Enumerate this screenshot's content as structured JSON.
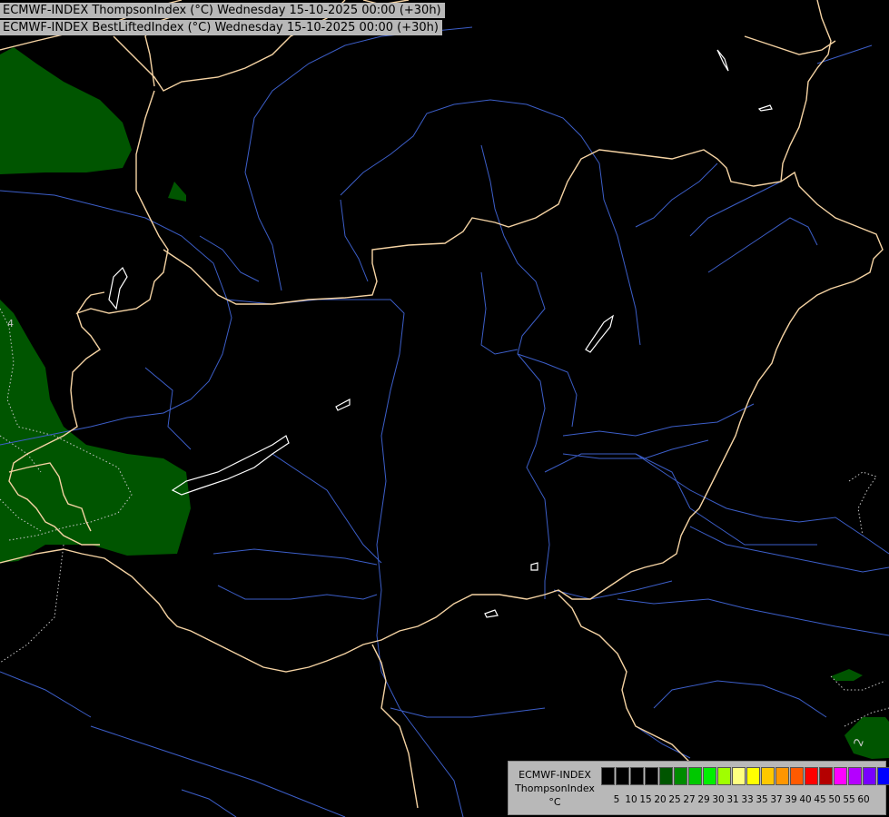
{
  "titles": {
    "line1": "ECMWF-INDEX ThompsonIndex (°C) Wednesday 15-10-2025 00:00 (+30h)",
    "line2": "ECMWF-INDEX BestLiftedIndex (°C) Wednesday 15-10-2025 00:00 (+30h)"
  },
  "legend": {
    "model": "ECMWF-INDEX",
    "parameter": "ThompsonIndex",
    "unit": "°C",
    "ticks": [
      "5",
      "10",
      "15",
      "20",
      "25",
      "27",
      "29",
      "30",
      "31",
      "33",
      "35",
      "37",
      "39",
      "40",
      "45",
      "50",
      "55",
      "60"
    ],
    "colors": [
      "#000000",
      "#000000",
      "#000000",
      "#000000",
      "#005500",
      "#008c00",
      "#00c800",
      "#00f000",
      "#a0ff00",
      "#ffff80",
      "#ffff00",
      "#ffc800",
      "#ff9600",
      "#ff5a00",
      "#ff0000",
      "#b40000",
      "#ff00ff",
      "#b400ff",
      "#7800ff",
      "#0000ff"
    ]
  },
  "map": {
    "colors": {
      "border": "#f5d3a3",
      "river": "#3c5ec8",
      "lake": "#ffffff",
      "shade": "#005500",
      "contour": "#c8c8c8"
    },
    "contour_labels": [
      "4",
      "2"
    ]
  }
}
